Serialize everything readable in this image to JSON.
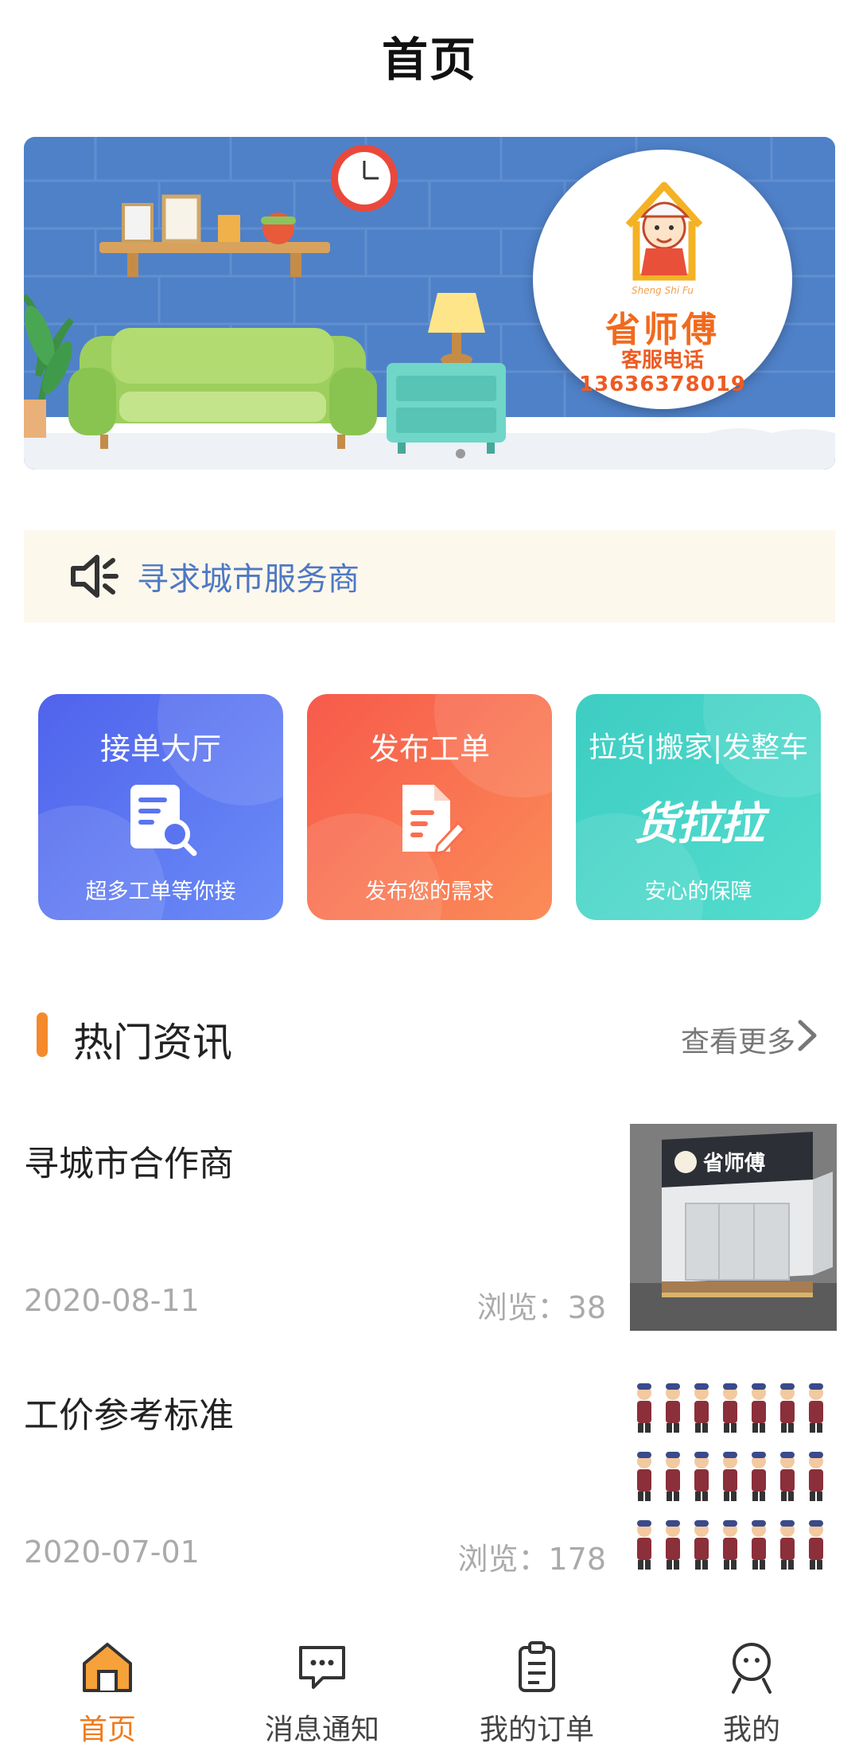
{
  "header": {
    "title": "首页"
  },
  "banner": {
    "brand_name": "省师傅",
    "brand_pinyin": "Sheng Shi Fu",
    "service_label": "客服电话",
    "service_phone": "13636378019"
  },
  "notice": {
    "icon": "speaker-icon",
    "text": "寻求城市服务商"
  },
  "cards": [
    {
      "title": "接单大厅",
      "subtitle": "超多工单等你接",
      "icon": "document-search-icon"
    },
    {
      "title": "发布工单",
      "subtitle": "发布您的需求",
      "icon": "document-edit-icon"
    },
    {
      "title": "拉货|搬家|发整车",
      "subtitle": "安心的保障",
      "logo_text": "货拉拉"
    }
  ],
  "section": {
    "title": "热门资讯",
    "more_label": "查看更多"
  },
  "news": [
    {
      "title": "寻城市合作商",
      "date": "2020-08-11",
      "views": "浏览：38",
      "thumb_sign": "省师傅"
    },
    {
      "title": "工价参考标准",
      "date": "2020-07-01",
      "views": "浏览：178"
    }
  ],
  "tabbar": [
    {
      "label": "首页",
      "icon": "home-icon",
      "active": true
    },
    {
      "label": "消息通知",
      "icon": "message-icon",
      "active": false
    },
    {
      "label": "我的订单",
      "icon": "clipboard-icon",
      "active": false
    },
    {
      "label": "我的",
      "icon": "user-icon",
      "active": false
    }
  ],
  "colors": {
    "accent": "#f07b1d",
    "notice_text": "#4e78c4",
    "card_blue": "#5a74f0",
    "card_orange": "#f96f50",
    "card_teal": "#48d5c8"
  }
}
